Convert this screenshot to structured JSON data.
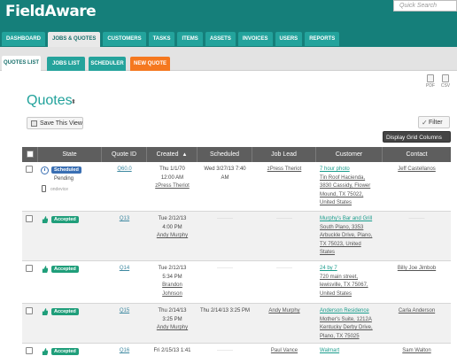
{
  "app": {
    "logo": "FieldAware",
    "search_placeholder": "Quick Search"
  },
  "nav": {
    "tabs": [
      "DASHBOARD",
      "JOBS & QUOTES",
      "CUSTOMERS",
      "TASKS",
      "ITEMS",
      "ASSETS",
      "INVOICES",
      "USERS",
      "REPORTS"
    ],
    "active": "JOBS & QUOTES"
  },
  "subnav": {
    "tabs": [
      "QUOTES LIST",
      "JOBS LIST",
      "SCHEDULER",
      "NEW QUOTE"
    ],
    "active": "QUOTES LIST"
  },
  "exports": {
    "pdf": "PDF",
    "csv": "CSV"
  },
  "page": {
    "title": "Quotes",
    "title_caret": "⬍"
  },
  "toolbar": {
    "save_view": "Save This View",
    "filter": "Filter",
    "display_columns": "Display Grid Columns"
  },
  "columns": {
    "state": "State",
    "quote_id": "Quote ID",
    "created": "Created",
    "created_sort": "▲",
    "scheduled": "Scheduled",
    "job_lead": "Job Lead",
    "customer": "Customer",
    "contact": "Contact"
  },
  "colors": {
    "brand": "#157f7a",
    "tab": "#23a39c",
    "accent_orange": "#f5781f",
    "accepted_badge": "#1f9e7a",
    "scheduled_badge": "#3a6fb3",
    "header_bg": "#5e5e5e"
  },
  "rows": [
    {
      "state": "Scheduled",
      "state_sub": "Pending",
      "state_extra": "ondevice",
      "quote_id": "Q60.0",
      "created_1": "Thu 1/1/70",
      "created_2": "12:00 AM",
      "created_3": "zPress Theriot",
      "created_4": "",
      "scheduled_1": "Wed 3/27/13 7:40",
      "scheduled_2": "AM",
      "job_lead": "zPress Theriot",
      "customer_1": "7 hour photo",
      "customer_2": "Tin Roof Hacienda,",
      "customer_3": "3830 Cassidy, Flower",
      "customer_4": "Mound, TX 75022,",
      "customer_5": "United States",
      "contact": "Jeff Castellanos"
    },
    {
      "state": "Accepted",
      "quote_id": "Q13",
      "created_1": "Tue 2/12/13",
      "created_2": "4:00 PM",
      "created_3": "Andy Murphy",
      "created_4": "",
      "scheduled_1": "———",
      "scheduled_2": "",
      "job_lead": "———",
      "customer_1": "Murphy's Bar and Grill",
      "customer_2": "South Plano, 3353",
      "customer_3": "Arbuckle Drive, Plano,",
      "customer_4": "TX 75023, United",
      "customer_5": "States",
      "contact": "———"
    },
    {
      "state": "Accepted",
      "quote_id": "Q14",
      "created_1": "Tue 2/12/13",
      "created_2": "5:34 PM",
      "created_3": "Brandon",
      "created_4": "Johnson",
      "scheduled_1": "———",
      "scheduled_2": "",
      "job_lead": "———",
      "customer_1": "24 by 7",
      "customer_2": "720 main street,",
      "customer_3": "lewisville, TX 75067,",
      "customer_4": "United States",
      "customer_5": "",
      "contact": "Billy Joe Jimbob"
    },
    {
      "state": "Accepted",
      "quote_id": "Q15",
      "created_1": "Thu 2/14/13",
      "created_2": "3:25 PM",
      "created_3": "Andy Murphy",
      "created_4": "",
      "scheduled_1": "Thu 2/14/13 3:25 PM",
      "scheduled_2": "",
      "job_lead": "Andy Murphy",
      "customer_1": "Anderson Residence",
      "customer_2": "Mother's Suite, 1212A",
      "customer_3": "Kentucky Derby Drive,",
      "customer_4": "Plano, TX 75025",
      "customer_5": "",
      "contact": "Carla Anderson"
    },
    {
      "state": "Accepted",
      "quote_id": "Q16",
      "created_1": "Fri 2/15/13 1:41",
      "created_2": "",
      "created_3": "",
      "created_4": "",
      "scheduled_1": "———",
      "scheduled_2": "",
      "job_lead": "Paul Vance",
      "customer_1": "Walmart",
      "customer_2": "",
      "customer_3": "",
      "customer_4": "",
      "customer_5": "",
      "contact": "Sam Walton"
    }
  ]
}
